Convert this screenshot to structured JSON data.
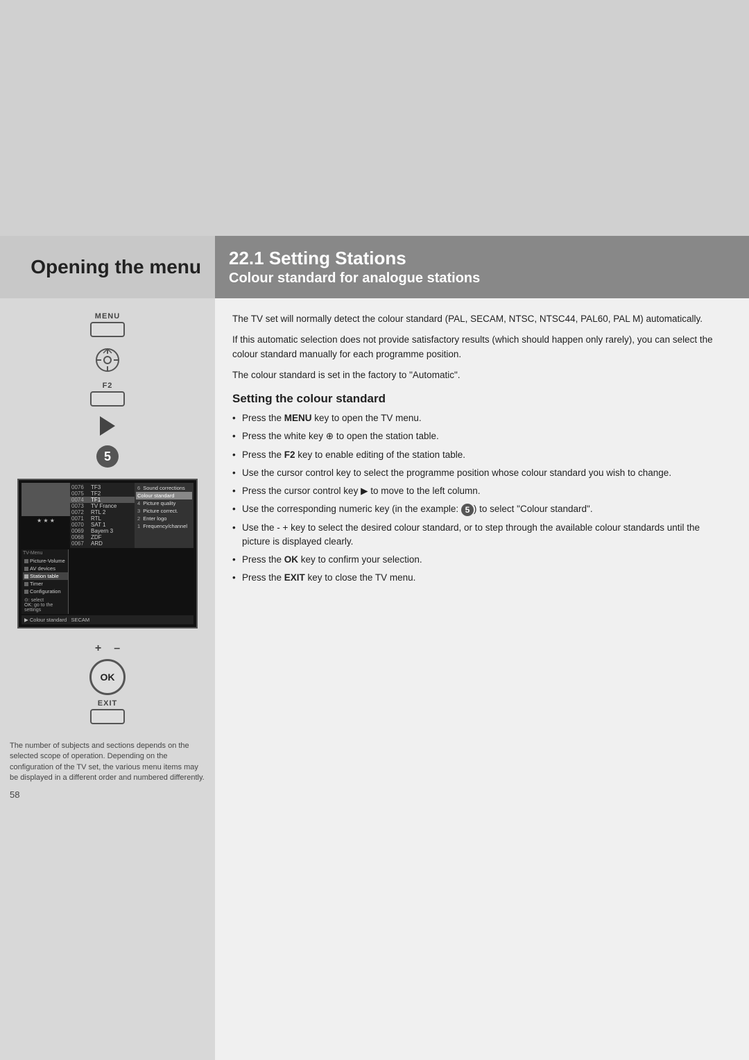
{
  "page": {
    "top_gray_height": 340,
    "background_color": "#e8e8e8"
  },
  "left_header": {
    "title": "Opening the menu"
  },
  "right_header": {
    "section_number": "22.1",
    "section_title": "Setting Stations",
    "subtitle": "Colour standard for analogue stations"
  },
  "remote": {
    "menu_label": "MENU",
    "f2_label": "F2",
    "number": "5",
    "ok_label": "OK",
    "exit_label": "EXIT",
    "plus_label": "+",
    "minus_label": "–"
  },
  "tv_screen": {
    "channels": [
      {
        "num": "0076",
        "name": "TF3"
      },
      {
        "num": "0075",
        "name": "TF2"
      },
      {
        "num": "0074",
        "name": "TF1",
        "highlighted": true
      },
      {
        "num": "0073",
        "name": "TV France"
      },
      {
        "num": "0072",
        "name": "RTL 2"
      },
      {
        "num": "0071",
        "name": "RTL"
      },
      {
        "num": "0070",
        "name": "SAT 1"
      },
      {
        "num": "0069",
        "name": "Bayern 3"
      },
      {
        "num": "0068",
        "name": "ZDF"
      },
      {
        "num": "0067",
        "name": "ARD"
      }
    ],
    "menu_items": [
      {
        "label": "Picture-Volume",
        "selected": false
      },
      {
        "label": "AV devices",
        "selected": false
      },
      {
        "label": "Station table",
        "selected": true
      },
      {
        "label": "Timer",
        "selected": false
      },
      {
        "label": "Configuration",
        "selected": false
      }
    ],
    "right_items": [
      {
        "num": "6",
        "label": "Sound corrections"
      },
      {
        "num": "",
        "label": "Colour standard",
        "highlighted": true
      },
      {
        "num": "4",
        "label": "Picture quality"
      },
      {
        "num": "3",
        "label": "Picture correct."
      },
      {
        "num": "2",
        "label": "Enter logo"
      },
      {
        "num": "1",
        "label": "Frequency/channel"
      }
    ],
    "hints": {
      "select": "select",
      "ok": "go to the settings"
    },
    "bottom_text": "Colour standard   SECAM",
    "vert_label": "TV-Menu"
  },
  "content": {
    "paragraph1": "The TV set will normally detect the colour standard (PAL, SECAM, NTSC, NTSC44, PAL60, PAL M) automatically.",
    "paragraph2": "If this automatic selection does not provide satisfactory results (which should happen only rarely), you can select the colour standard manually for each programme position.",
    "paragraph3": "The colour standard is set in the factory to \"Automatic\".",
    "subsection_title": "Setting the colour standard",
    "bullets": [
      "Press the <b>MENU</b> key to open the TV menu.",
      "Press the white key ⊕ to open the station table.",
      "Press the <b>F2</b> key to enable editing of the station table.",
      "Use the cursor control key to select the programme position whose colour standard you wish to change.",
      "Press the cursor control key ▶ to move to the left column.",
      "Use the corresponding numeric key (in the example: <num>5</num>) to select \"Colour standard\".",
      "Use the - + key to select the desired colour standard, or to step through the available colour standards until the picture is displayed clearly.",
      "Press the <b>OK</b> key to confirm your selection.",
      "Press the <b>EXIT</b> key to close the TV menu."
    ]
  },
  "footer": {
    "note": "The number of subjects and sections depends on the selected scope of operation. Depending on the configuration of the TV set, the various menu items may be displayed in a different order and numbered differently.",
    "page_number": "58"
  }
}
